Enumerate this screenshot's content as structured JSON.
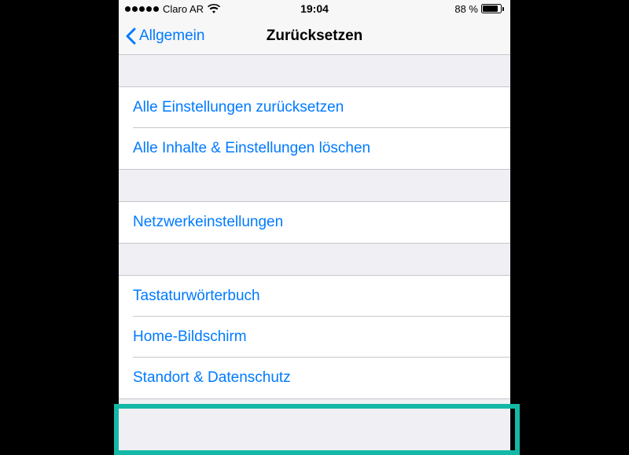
{
  "statusBar": {
    "carrier": "Claro AR",
    "time": "19:04",
    "batteryPct": "88 %"
  },
  "navBar": {
    "back": "Allgemein",
    "title": "Zurücksetzen"
  },
  "group1": {
    "item0": "Alle Einstellungen zurücksetzen",
    "item1": "Alle Inhalte & Einstellungen löschen"
  },
  "group2": {
    "item0": "Netzwerkeinstellungen"
  },
  "group3": {
    "item0": "Tastaturwörterbuch",
    "item1": "Home-Bildschirm",
    "item2": "Standort & Datenschutz"
  }
}
